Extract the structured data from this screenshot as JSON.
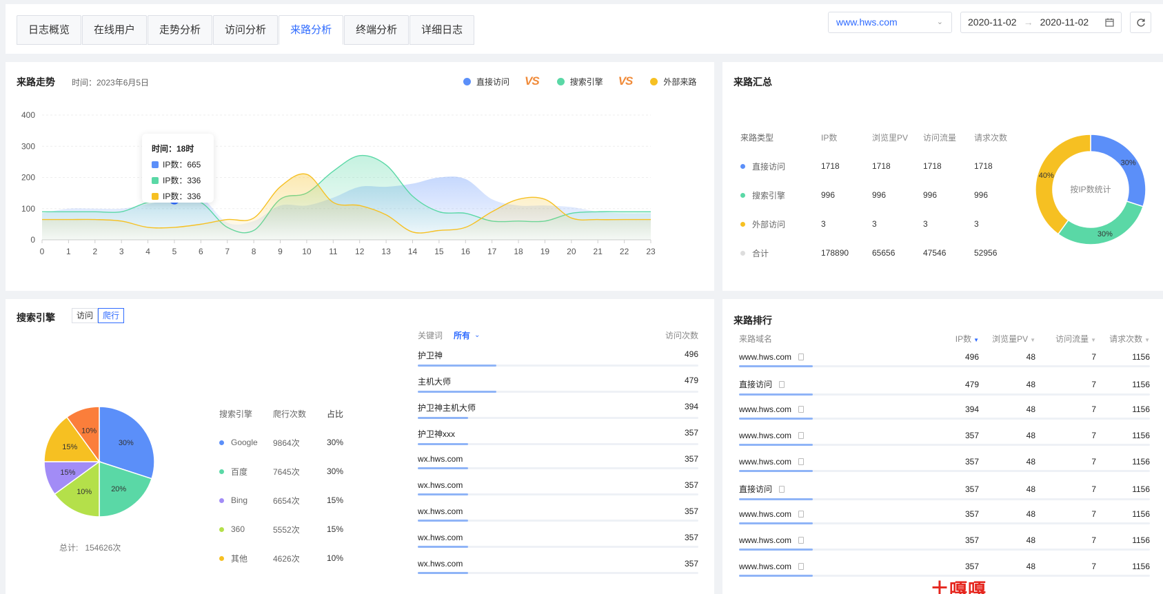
{
  "tabs": [
    "日志概览",
    "在线用户",
    "走势分析",
    "访问分析",
    "来路分析",
    "终端分析",
    "详细日志"
  ],
  "active_tab": 4,
  "site_select": "www.hws.com",
  "date_start": "2020-11-02",
  "date_end": "2020-11-02",
  "trend": {
    "title": "来路走势",
    "time_label": "时间：2023年6月5日",
    "legend": [
      "直接访问",
      "搜索引擎",
      "外部来路"
    ],
    "vs": "VS",
    "tooltip": {
      "time": "时间：18时",
      "rows": [
        "IP数：665",
        "IP数：336",
        "IP数：336"
      ]
    }
  },
  "colors": {
    "blue": "#5b8ff9",
    "green": "#5ad8a6",
    "yellow": "#f6c022",
    "accent": "#2f6bff",
    "purple": "#a28cf6",
    "lime": "#b4e04a",
    "orange": "#fb7e3b"
  },
  "chart_data": [
    {
      "type": "area",
      "x": [
        0,
        1,
        2,
        3,
        4,
        5,
        6,
        7,
        8,
        9,
        10,
        11,
        12,
        13,
        14,
        15,
        16,
        17,
        18,
        19,
        20,
        21,
        22,
        23
      ],
      "ylim": [
        0,
        400
      ],
      "yticks": [
        0,
        100,
        200,
        300,
        400
      ],
      "series": [
        {
          "name": "直接访问",
          "values": [
            85,
            100,
            100,
            100,
            115,
            130,
            135,
            55,
            60,
            110,
            110,
            135,
            170,
            170,
            180,
            200,
            195,
            130,
            110,
            110,
            105,
            90,
            85,
            85
          ]
        },
        {
          "name": "搜索引擎",
          "values": [
            90,
            90,
            90,
            90,
            120,
            125,
            120,
            40,
            30,
            130,
            150,
            220,
            270,
            240,
            140,
            90,
            85,
            60,
            60,
            60,
            85,
            90,
            90,
            90
          ]
        },
        {
          "name": "外部来路",
          "values": [
            65,
            65,
            65,
            60,
            40,
            40,
            50,
            65,
            70,
            170,
            210,
            120,
            110,
            80,
            25,
            30,
            40,
            90,
            130,
            130,
            70,
            65,
            65,
            65
          ]
        }
      ]
    },
    {
      "type": "pie",
      "title": "按IP数统计",
      "categories": [
        "直接访问",
        "搜索引擎",
        "外部访问"
      ],
      "values": [
        30,
        30,
        40
      ],
      "labels": [
        "30%",
        "30%",
        "40%"
      ]
    },
    {
      "type": "pie",
      "categories": [
        "Google",
        "百度",
        "Bing",
        "360",
        "其他"
      ],
      "values": [
        30,
        20,
        15,
        10,
        15,
        10
      ],
      "labels": [
        "30%",
        "20%",
        "10%",
        "15%",
        "15%",
        "10%"
      ]
    }
  ],
  "summary": {
    "title": "来路汇总",
    "headers": [
      "来路类型",
      "IP数",
      "浏览里PV",
      "访问流量",
      "请求次数"
    ],
    "rows": [
      {
        "name": "直接访问",
        "color": "#5b8ff9",
        "v": [
          "1718",
          "1718",
          "1718",
          "1718"
        ]
      },
      {
        "name": "搜索引擎",
        "color": "#5ad8a6",
        "v": [
          "996",
          "996",
          "996",
          "996"
        ]
      },
      {
        "name": "外部访问",
        "color": "#f6c022",
        "v": [
          "3",
          "3",
          "3",
          "3"
        ]
      },
      {
        "name": "合计",
        "color": "#dddddd",
        "v": [
          "178890",
          "65656",
          "47546",
          "52956"
        ]
      }
    ]
  },
  "search": {
    "title": "搜索引擎",
    "toggle": [
      "访问",
      "爬行"
    ],
    "total": "总计:   154626次",
    "headers": [
      "搜索引擎",
      "爬行次数",
      "占比"
    ],
    "rows": [
      {
        "name": "Google",
        "count": "9864次",
        "pct": "30%",
        "color": "#5b8ff9"
      },
      {
        "name": "百度",
        "count": "7645次",
        "pct": "30%",
        "color": "#5ad8a6"
      },
      {
        "name": "Bing",
        "count": "6654次",
        "pct": "15%",
        "color": "#a28cf6"
      },
      {
        "name": "360",
        "count": "5552次",
        "pct": "15%",
        "color": "#b4e04a"
      },
      {
        "name": "其他",
        "count": "4626次",
        "pct": "10%",
        "color": "#f6c022"
      }
    ]
  },
  "keywords": {
    "label": "关键词",
    "select": "所有",
    "count_header": "访问次数",
    "rows": [
      {
        "k": "护卫神",
        "v": "496",
        "p": 0.28
      },
      {
        "k": "主机大师",
        "v": "479",
        "p": 0.28
      },
      {
        "k": "护卫神主机大师",
        "v": "394",
        "p": 0.18
      },
      {
        "k": "护卫神xxx",
        "v": "357",
        "p": 0.18
      },
      {
        "k": "wx.hws.com",
        "v": "357",
        "p": 0.18
      },
      {
        "k": "wx.hws.com",
        "v": "357",
        "p": 0.18
      },
      {
        "k": "wx.hws.com",
        "v": "357",
        "p": 0.18
      },
      {
        "k": "wx.hws.com",
        "v": "357",
        "p": 0.18
      },
      {
        "k": "wx.hws.com",
        "v": "357",
        "p": 0.18
      }
    ]
  },
  "rank": {
    "title": "来路排行",
    "headers": [
      "来路域名",
      "IP数",
      "浏览量PV",
      "访问流量",
      "请求次数"
    ],
    "rows": [
      {
        "d": "www.hws.com",
        "ip": "496",
        "pv": "48",
        "fl": "7",
        "rq": "1156",
        "p": 0.18
      },
      {
        "d": "直接访问",
        "ip": "479",
        "pv": "48",
        "fl": "7",
        "rq": "1156",
        "p": 0.18
      },
      {
        "d": "www.hws.com",
        "ip": "394",
        "pv": "48",
        "fl": "7",
        "rq": "1156",
        "p": 0.18
      },
      {
        "d": "www.hws.com",
        "ip": "357",
        "pv": "48",
        "fl": "7",
        "rq": "1156",
        "p": 0.18
      },
      {
        "d": "www.hws.com",
        "ip": "357",
        "pv": "48",
        "fl": "7",
        "rq": "1156",
        "p": 0.18
      },
      {
        "d": "直接访问",
        "ip": "357",
        "pv": "48",
        "fl": "7",
        "rq": "1156",
        "p": 0.18
      },
      {
        "d": "www.hws.com",
        "ip": "357",
        "pv": "48",
        "fl": "7",
        "rq": "1156",
        "p": 0.18
      },
      {
        "d": "www.hws.com",
        "ip": "357",
        "pv": "48",
        "fl": "7",
        "rq": "1156",
        "p": 0.18
      },
      {
        "d": "www.hws.com",
        "ip": "357",
        "pv": "48",
        "fl": "7",
        "rq": "1156",
        "p": 0.18
      }
    ]
  },
  "watermark": "土嘎嘎 www.tugaga.com"
}
